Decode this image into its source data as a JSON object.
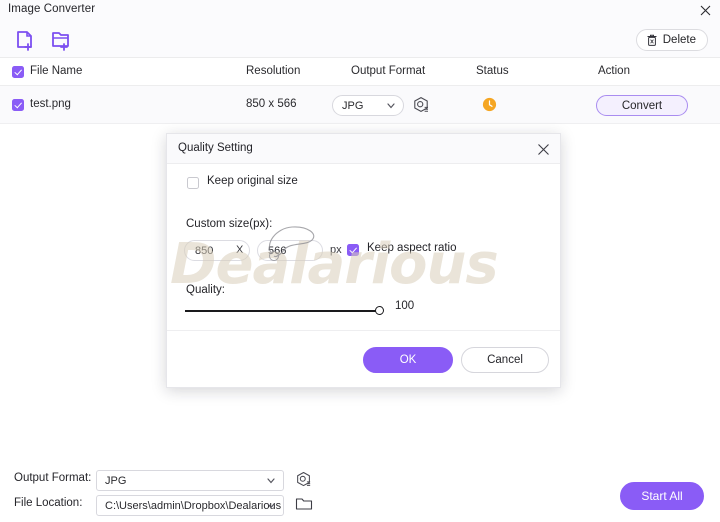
{
  "window": {
    "title": "Image Converter",
    "close_icon": "close-icon"
  },
  "toolbar": {
    "add_file_icon": "add-file-icon",
    "add_folder_icon": "add-folder-icon",
    "delete_label": "Delete",
    "delete_icon": "trash-icon"
  },
  "file_list": {
    "columns": [
      "File Name",
      "Resolution",
      "Output Format",
      "Status",
      "Action"
    ],
    "select_all_checked": true,
    "rows": [
      {
        "selected": true,
        "name": "test.png",
        "resolution": "850 x 566",
        "format": "JPG",
        "settings_icon": "image-settings-icon",
        "status_icon": "pending-clock-icon",
        "action_label": "Convert"
      }
    ]
  },
  "dialog": {
    "title": "Quality Setting",
    "close_icon": "close-icon",
    "keep_original_size": {
      "label": "Keep original size",
      "checked": false
    },
    "custom_size": {
      "label": "Custom size(px):",
      "width": "850",
      "separator": "X",
      "height": "566",
      "unit": "px"
    },
    "keep_aspect_ratio": {
      "label": "Keep aspect ratio",
      "checked": true
    },
    "quality": {
      "label": "Quality:",
      "value": "100",
      "min": 0,
      "max": 100
    },
    "ok_label": "OK",
    "cancel_label": "Cancel"
  },
  "watermark": {
    "text": "Dealarious"
  },
  "bottom": {
    "output_format_label": "Output Format:",
    "output_format_value": "JPG",
    "output_format_icon": "image-settings-icon",
    "file_location_label": "File Location:",
    "file_location_value": "C:\\Users\\admin\\Dropbox\\Dealarious",
    "file_location_icon": "folder-icon",
    "start_all_label": "Start All"
  },
  "colors": {
    "accent": "#8a5cf6",
    "accent_soft": "#f4f0fe",
    "status_pending": "#f5a623",
    "watermark": "#d9cfbb"
  }
}
